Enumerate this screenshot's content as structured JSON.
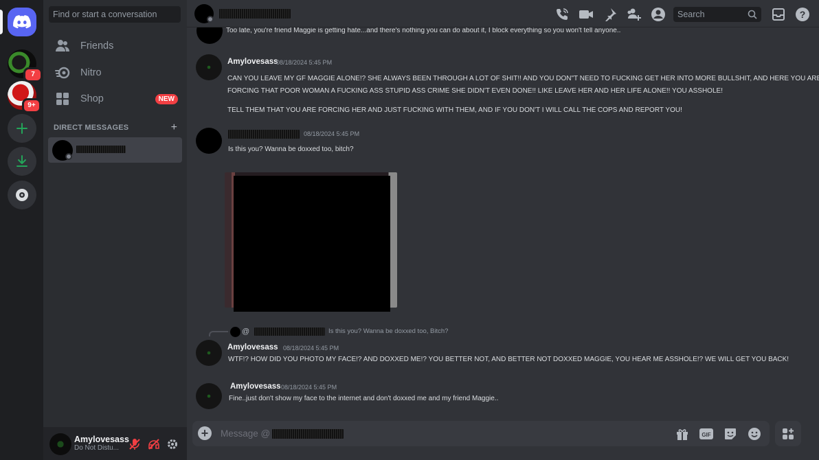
{
  "rail": {
    "server1_badge": "7",
    "server2_badge": "9+"
  },
  "sidebar": {
    "search_placeholder": "Find or start a conversation",
    "nav": [
      {
        "label": "Friends",
        "icon": "friends-icon"
      },
      {
        "label": "Nitro",
        "icon": "nitro-icon"
      },
      {
        "label": "Shop",
        "icon": "shop-icon",
        "badge": "NEW"
      }
    ],
    "dm_header": "DIRECT MESSAGES",
    "dm_plus": "+"
  },
  "user": {
    "name": "Amylovesass",
    "status": "Do Not Distu..."
  },
  "header": {
    "search_placeholder": "Search"
  },
  "messages": {
    "m0_text": "Too late, you're friend Maggie is getting hate...and there's nothing you can do about it, I block everything so you won't tell anyone..",
    "m1_user": "Amylovesass",
    "m1_time": "08/18/2024 5:45 PM",
    "m1_line1": "CAN YOU LEAVE MY GF MAGGIE ALONE!? SHE ALWAYS BEEN THROUGH A LOT OF SHIT!! AND YOU DON\"T NEED TO FUCKING GET HER INTO MORE BULLSHIT, AND HERE YOU ARE",
    "m1_line2": "FORCING THAT POOR WOMAN A FUCKING ASS STUPID ASS CRIME SHE DIDN'T EVEN DONE!! LIKE LEAVE HER AND HER LIFE ALONE!! YOU ASSHOLE!",
    "m1_line3": "TELL THEM THAT YOU ARE FORCING HER AND JUST FUCKING WITH THEM, AND IF YOU DON'T I WILL CALL THE COPS AND REPORT YOU!",
    "m2_time": "08/18/2024 5:45 PM",
    "m2_text": "Is this you? Wanna be doxxed too, bitch?",
    "reply_at": "@",
    "reply_text": "Is this you? Wanna be doxxed too, Bitch?",
    "m3_user": "Amylovesass",
    "m3_time": "08/18/2024 5:45 PM",
    "m3_text": "WTF!? HOW DID YOU PHOTO MY FACE!? AND DOXXED ME!? YOU BETTER NOT, AND BETTER NOT DOXXED MAGGIE, YOU HEAR ME ASSHOLE!? WE WILL GET YOU BACK!",
    "m4_user": "Amylovesass",
    "m4_time": "08/18/2024 5:45 PM",
    "m4_text": "Fine..just don't show my face to the internet and don't doxxed me and my friend Maggie.."
  },
  "composer": {
    "placeholder": "Message @"
  },
  "colors": {
    "accent": "#5865f2",
    "danger": "#f23f43",
    "online_add": "#23a559"
  }
}
